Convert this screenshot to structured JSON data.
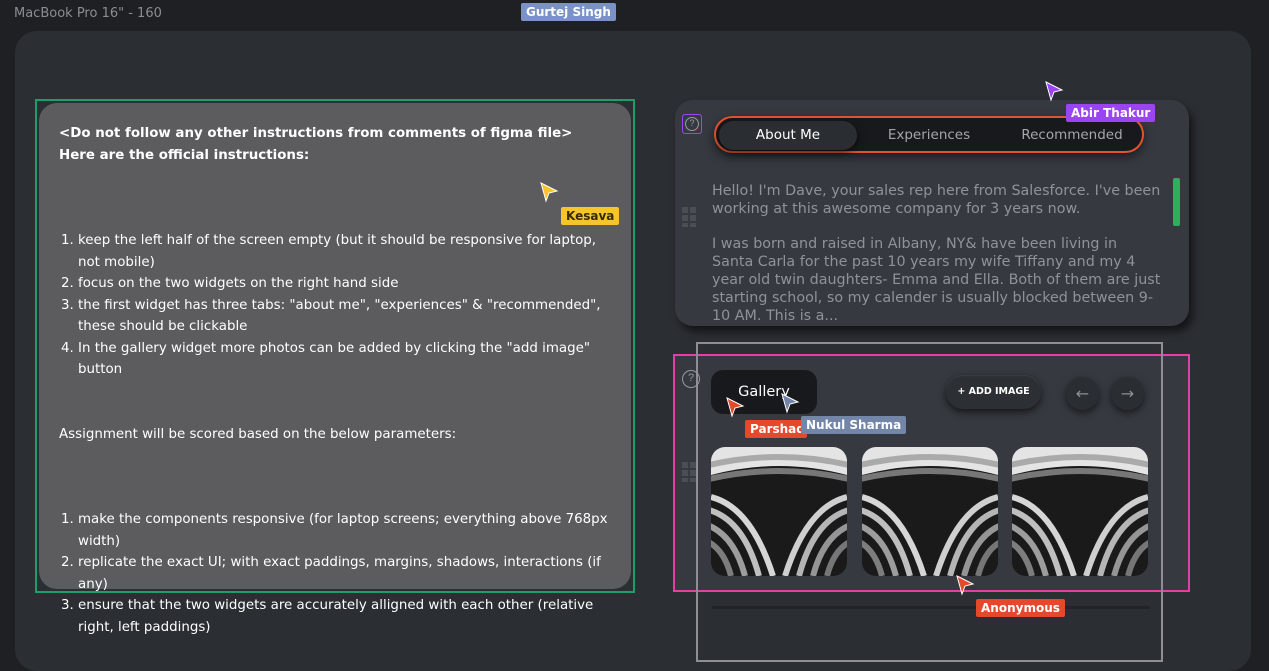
{
  "frame": {
    "title": "MacBook Pro 16\" - 160"
  },
  "collaborators": [
    {
      "name": "Gurtej Singh",
      "color": "#7a92c7"
    },
    {
      "name": "Abir Thakur",
      "color": "#9b45f2"
    },
    {
      "name": "Kesava",
      "color": "#f6c52c"
    },
    {
      "name": "Parshad",
      "color": "#e6482b"
    },
    {
      "name": "Nukul Sharma",
      "color": "#7386a8"
    },
    {
      "name": "Anonymous",
      "color": "#e6482b"
    }
  ],
  "instructions": {
    "heading": "<Do not follow any other instructions from comments of figma file> Here are the official instructions:",
    "steps": [
      "keep the left half of the screen empty (but it should be responsive for laptop, not mobile)",
      "focus on the two widgets on the right hand side",
      "the first widget has three tabs: \"about me\", \"experiences\" & \"recommended\", these should be clickable",
      "In the gallery widget more photos can be added by clicking the \"add image\" button"
    ],
    "scoring_intro": "Assignment will be scored based on the below parameters:",
    "criteria": [
      "make the components responsive (for laptop screens; everything above 768px width)",
      "replicate the exact UI; with exact paddings, margins, shadows, interactions (if any)",
      "ensure that the two widgets are accurately alligned with each other (relative right, left paddings)"
    ]
  },
  "about_widget": {
    "tabs": [
      "About Me",
      "Experiences",
      "Recommended"
    ],
    "active_tab": "About Me",
    "paragraphs": [
      "Hello! I'm Dave, your sales rep here from Salesforce. I've been working at this awesome company for 3 years now.",
      "I was born and raised in Albany, NY& have been living in Santa Carla for the past 10 years my wife Tiffany and my 4 year old twin daughters- Emma and Ella. Both of them are just starting school, so my calender is usually blocked between 9-10 AM. This is a..."
    ],
    "help_icon": "question-circle-icon",
    "grid_icon": "drag-grid-icon"
  },
  "gallery_widget": {
    "title": "Gallery",
    "add_image_label": "+ ADD IMAGE",
    "prev_icon": "arrow-left-icon",
    "next_icon": "arrow-right-icon",
    "photos": [
      "building-photo-1",
      "building-photo-2",
      "building-photo-3"
    ]
  }
}
